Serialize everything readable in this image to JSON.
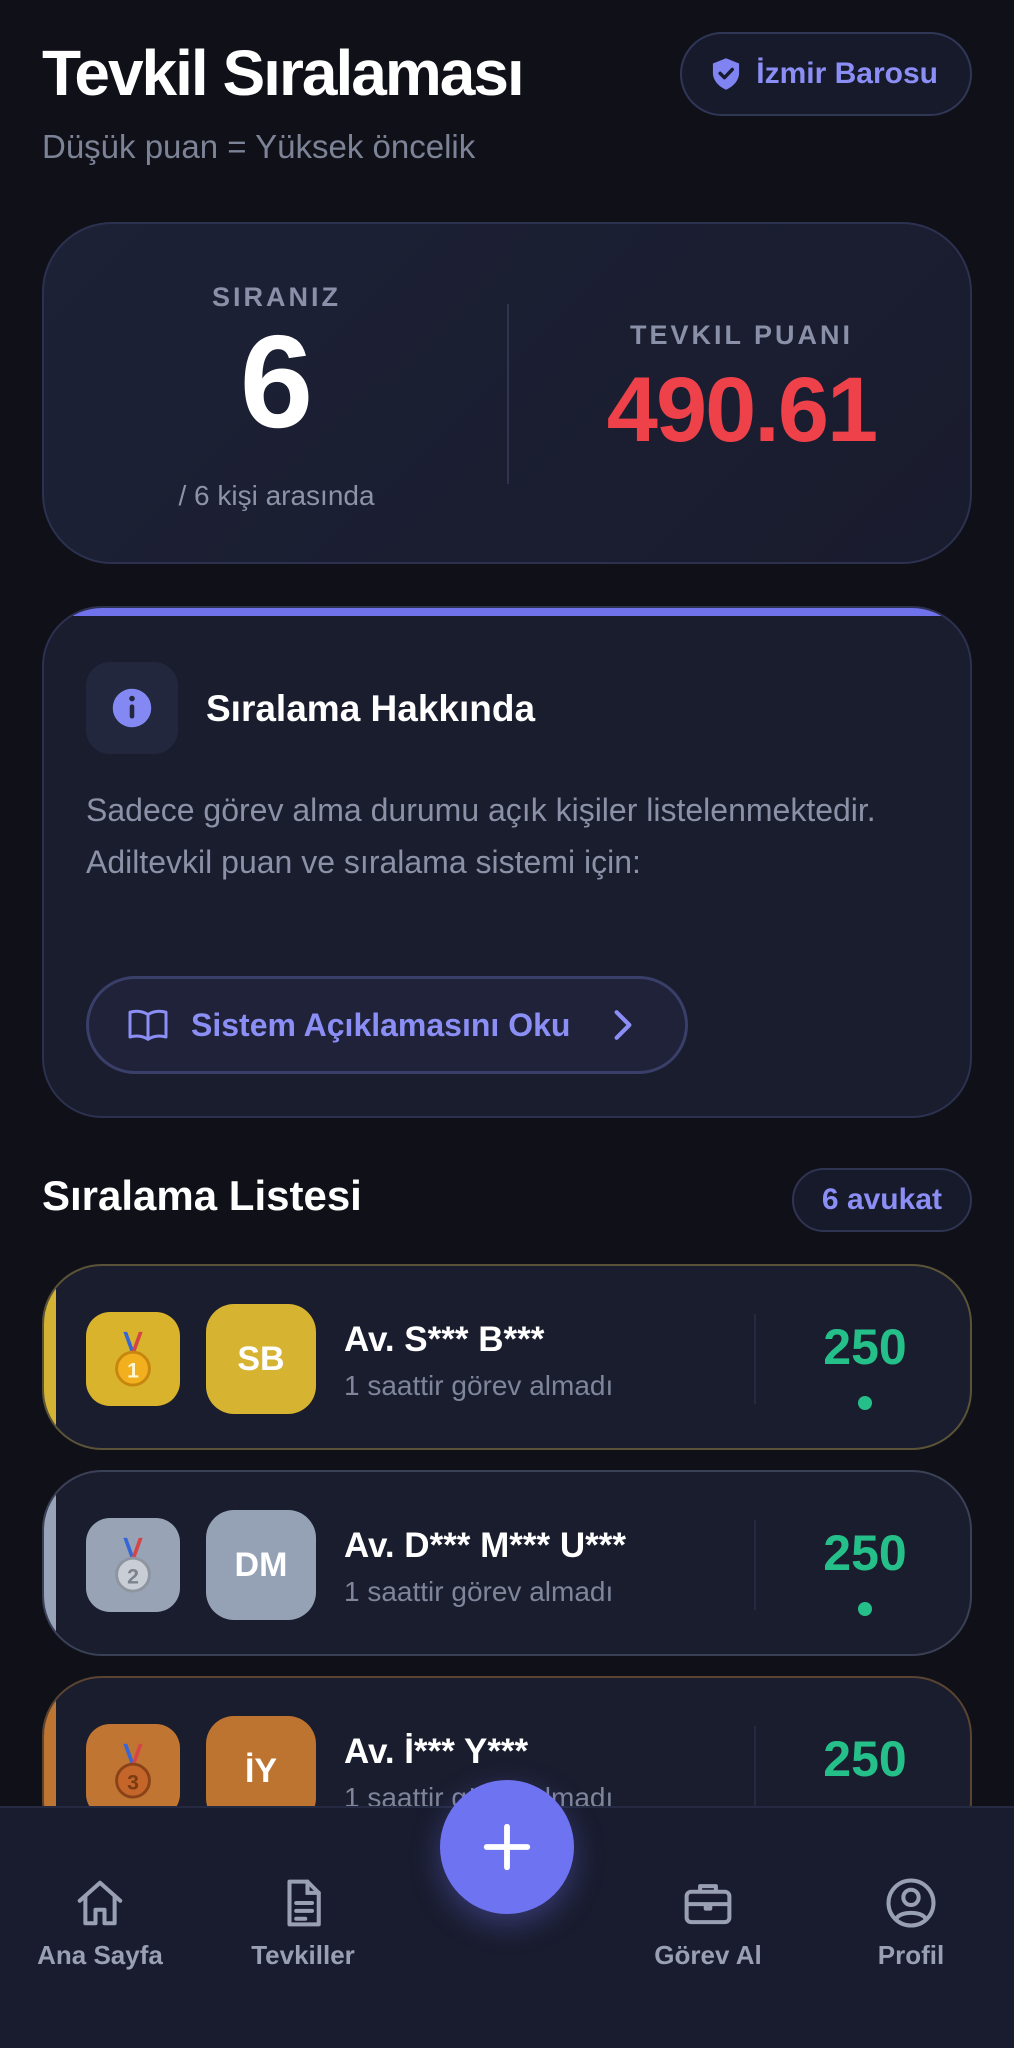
{
  "header": {
    "title": "Tevkil Sıralaması",
    "subtitle": "Düşük puan = Yüksek öncelik",
    "bar_badge": {
      "icon": "shield-check-icon",
      "label": "İzmir Barosu"
    }
  },
  "stats": {
    "rank_label": "SIRANIZ",
    "rank_value": "6",
    "rank_sub": "/ 6 kişi arasında",
    "score_label": "TEVKIL PUANI",
    "score_value": "490.61",
    "score_color": "#ee4149"
  },
  "info": {
    "icon": "info-icon",
    "title": "Sıralama Hakkında",
    "text": "Sadece görev alma durumu açık kişiler listelenmektedir. Adiltevkil puan ve sıralama sistemi için:",
    "button_label": "Sistem Açıklamasını Oku",
    "button_icon": "book-icon",
    "accent_color": "#6f72ea"
  },
  "list": {
    "title": "Sıralama Listesi",
    "count_label": "6 avukat",
    "items": [
      {
        "rank": "1",
        "medal": "gold-medal-icon",
        "initials": "SB",
        "name": "Av. S*** B***",
        "status": "1 saattir görev almadı",
        "score": "250",
        "color": "#d4b234",
        "medal_bg": "#d9b32c"
      },
      {
        "rank": "2",
        "medal": "silver-medal-icon",
        "initials": "DM",
        "name": "Av. D*** M*** U***",
        "status": "1 saattir görev almadı",
        "score": "250",
        "color": "#97a3b8",
        "medal_bg": "#98a3b6"
      },
      {
        "rank": "3",
        "medal": "bronze-medal-icon",
        "initials": "İY",
        "name": "Av. İ*** Y***",
        "status": "1 saattir görev almadı",
        "score": "250",
        "color": "#bf7532",
        "medal_bg": "#c07532"
      }
    ],
    "score_color": "#25c08a"
  },
  "nav": {
    "items": [
      {
        "label": "Ana Sayfa",
        "icon": "home-icon"
      },
      {
        "label": "Tevkiller",
        "icon": "document-icon"
      },
      {
        "label": "Görev Al",
        "icon": "briefcase-icon"
      },
      {
        "label": "Profil",
        "icon": "user-circle-icon"
      }
    ],
    "fab_icon": "plus-icon",
    "fab_color": "#6e73f1"
  }
}
